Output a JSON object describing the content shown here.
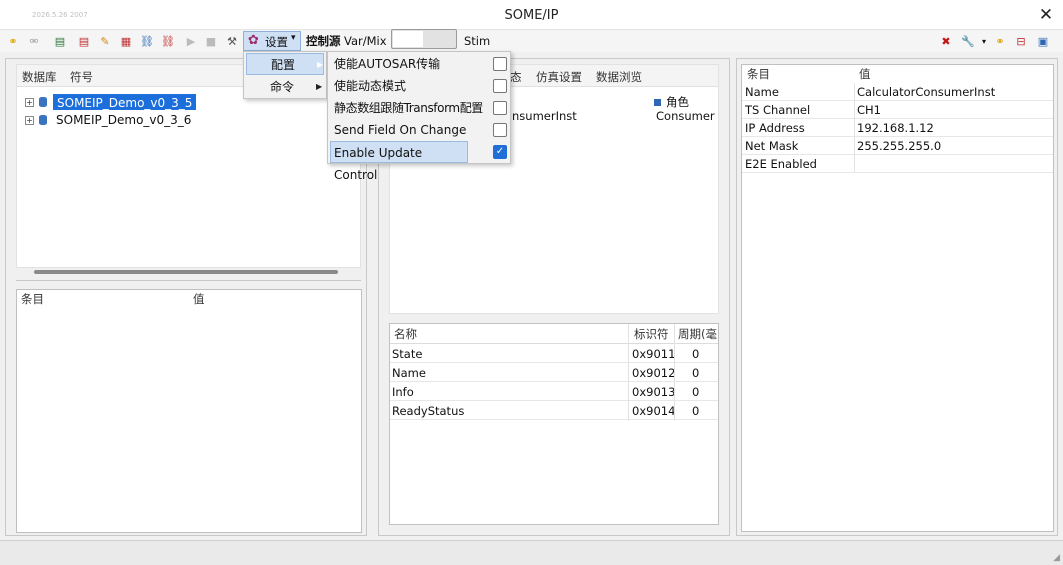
{
  "window": {
    "title": "SOME/IP",
    "timestamp": "2026.5.26 2007"
  },
  "toolbar": {
    "settings_label": "设置",
    "control_source_label": "控制源",
    "var_mix_label": "Var/Mix",
    "stim_label": "Stim"
  },
  "menu": {
    "items": [
      {
        "label": "配置"
      },
      {
        "label": "命令"
      }
    ],
    "submenu": [
      {
        "label": "使能AUTOSAR传输",
        "checked": false
      },
      {
        "label": "使能动态模式",
        "checked": false
      },
      {
        "label": "静态数组跟随Transform配置",
        "checked": false
      },
      {
        "label": "Send Field On Change",
        "checked": false
      },
      {
        "label": "Enable Update Control",
        "checked": true
      }
    ]
  },
  "left_panel": {
    "tabs": [
      "数据库",
      "符号"
    ],
    "tree": [
      "SOMEIP_Demo_v0_3_5",
      "SOMEIP_Demo_v0_3_6"
    ],
    "props_headers": [
      "条目",
      "值"
    ]
  },
  "middle_panel": {
    "tabs": [
      "态",
      "仿真设置",
      "数据浏览"
    ],
    "role_header": "角色",
    "consumer_name_partial": "nsumerInst",
    "consumer_role": "Consumer",
    "signal_headers": [
      "名称",
      "标识符",
      "周期(毫"
    ],
    "signals": [
      {
        "name": "State",
        "id": "0x9011",
        "period": "0"
      },
      {
        "name": "Name",
        "id": "0x9012",
        "period": "0"
      },
      {
        "name": "Info",
        "id": "0x9013",
        "period": "0"
      },
      {
        "name": "ReadyStatus",
        "id": "0x9014",
        "period": "0"
      }
    ]
  },
  "right_panel": {
    "headers": [
      "条目",
      "值"
    ],
    "rows": [
      {
        "key": "Name",
        "value": "CalculatorConsumerInst"
      },
      {
        "key": "TS Channel",
        "value": "CH1"
      },
      {
        "key": "IP Address",
        "value": "192.168.1.12"
      },
      {
        "key": "Net Mask",
        "value": "255.255.255.0"
      },
      {
        "key": "E2E Enabled",
        "value": ""
      }
    ]
  }
}
